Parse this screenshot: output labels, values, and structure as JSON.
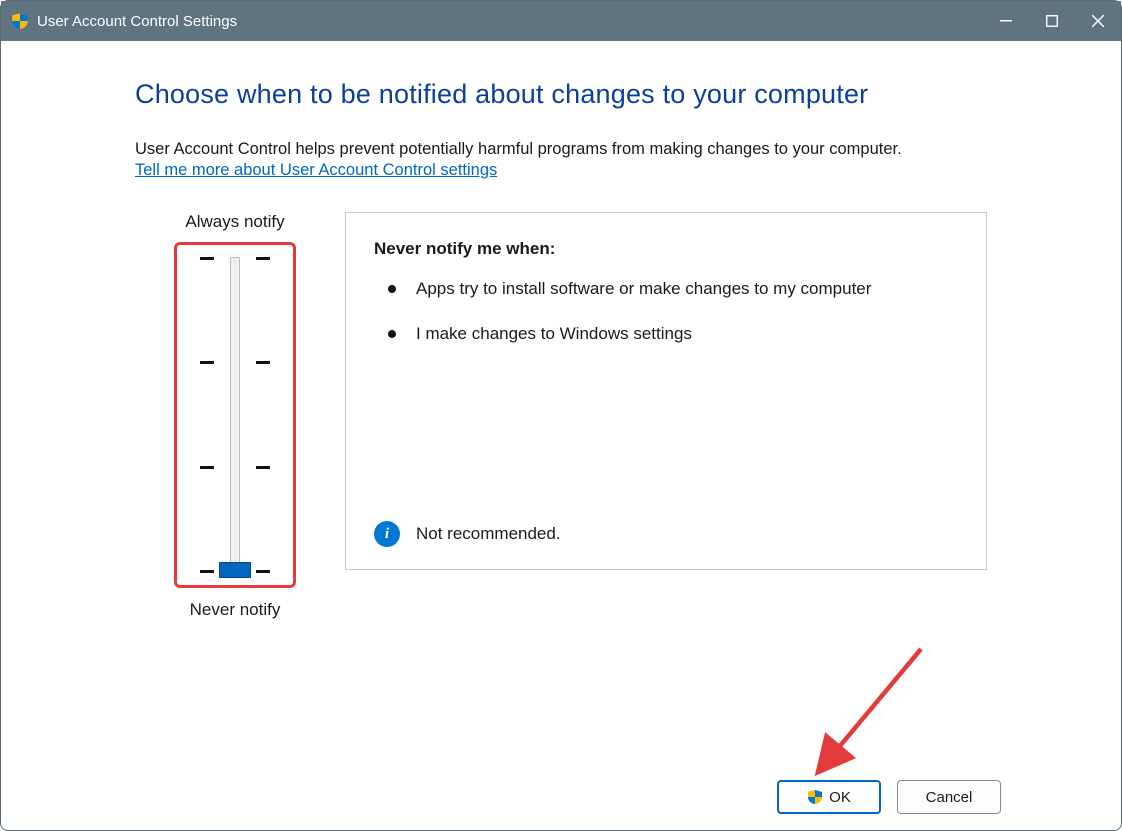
{
  "titlebar": {
    "title": "User Account Control Settings"
  },
  "page": {
    "heading": "Choose when to be notified about changes to your computer",
    "description": "User Account Control helps prevent potentially harmful programs from making changes to your computer.",
    "help_link": "Tell me more about User Account Control settings"
  },
  "slider": {
    "top_label": "Always notify",
    "bottom_label": "Never notify"
  },
  "panel": {
    "heading": "Never notify me when:",
    "items": [
      "Apps try to install software or make changes to my computer",
      "I make changes to Windows settings"
    ],
    "recommendation": "Not recommended."
  },
  "footer": {
    "ok": "OK",
    "cancel": "Cancel"
  }
}
